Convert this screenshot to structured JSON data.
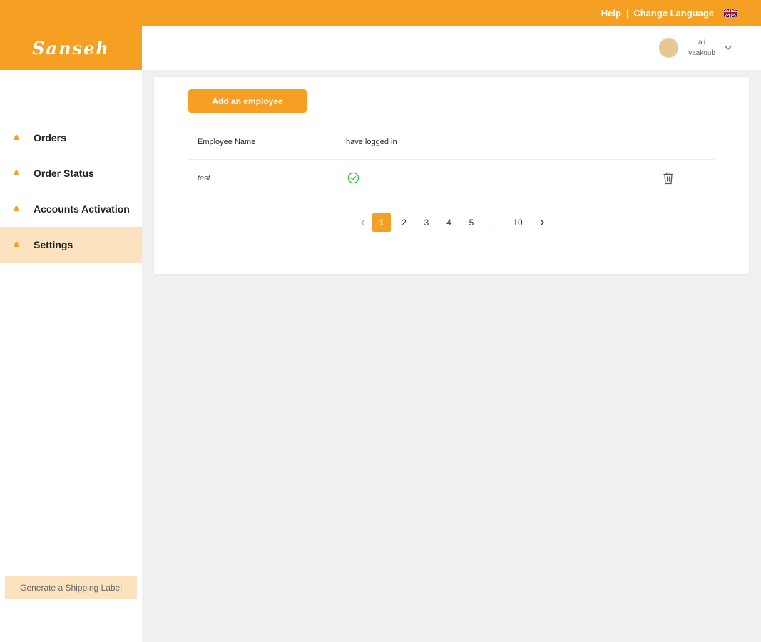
{
  "topbar": {
    "help_label": "Help",
    "separator": "|",
    "change_language_label": "Change Language"
  },
  "brand": {
    "logo_text": "Sanseh"
  },
  "user": {
    "name_line1": "ali",
    "name_line2": "yaakoub"
  },
  "sidebar": {
    "items": [
      {
        "label": "Orders",
        "icon": "bell-icon",
        "active": false
      },
      {
        "label": "Order Status",
        "icon": "bell-icon",
        "active": false
      },
      {
        "label": "Accounts Activation",
        "icon": "bell-icon",
        "active": false
      },
      {
        "label": "Settings",
        "icon": "bell-icon",
        "active": true
      }
    ],
    "shipping_label_button": "Generate a Shipping Label"
  },
  "main": {
    "add_employee_button": "Add an employee",
    "table": {
      "headers": [
        "Employee Name",
        "have logged in"
      ],
      "rows": [
        {
          "name": "test",
          "logged_in": true
        }
      ]
    },
    "pagination": {
      "pages": [
        "1",
        "2",
        "3",
        "4",
        "5",
        "...",
        "10"
      ],
      "current": "1"
    }
  },
  "colors": {
    "accent": "#f5a023",
    "accent_light": "#fde2bf",
    "success": "#2ecc40"
  }
}
